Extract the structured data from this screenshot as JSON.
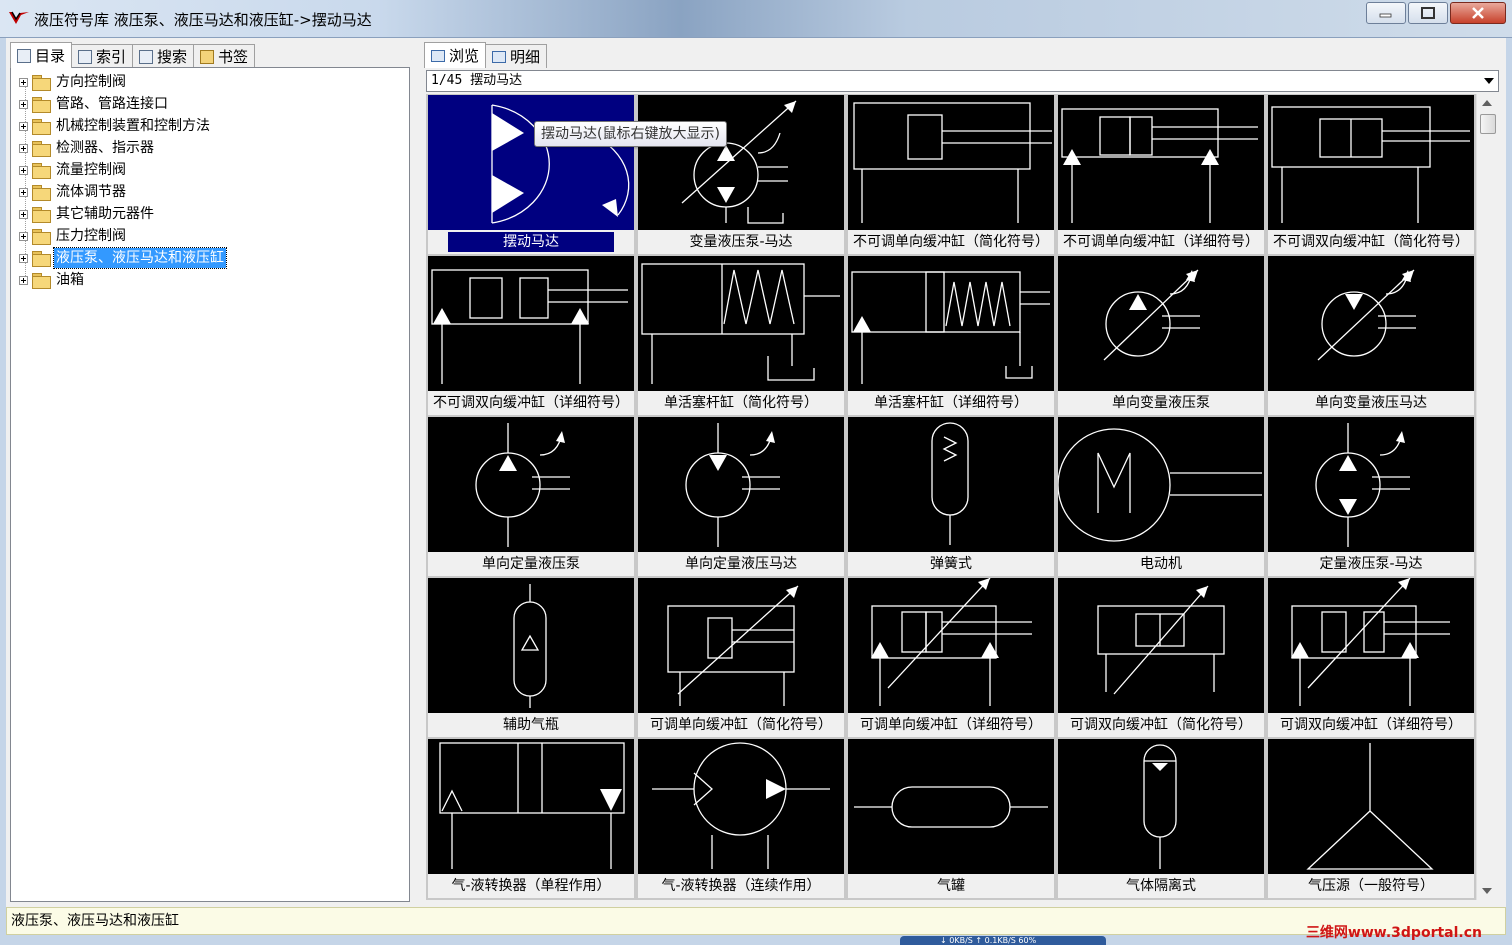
{
  "window": {
    "title": "液压符号库 液压泵、液压马达和液压缸->摆动马达"
  },
  "left_tabs": [
    {
      "label": "目录",
      "icon": "catalog-icon"
    },
    {
      "label": "索引",
      "icon": "index-icon"
    },
    {
      "label": "搜索",
      "icon": "search-icon"
    },
    {
      "label": "书签",
      "icon": "bookmark-icon"
    }
  ],
  "tree": [
    {
      "label": "方向控制阀"
    },
    {
      "label": "管路、管路连接口"
    },
    {
      "label": "机械控制装置和控制方法"
    },
    {
      "label": "检测器、指示器"
    },
    {
      "label": "流量控制阀"
    },
    {
      "label": "流体调节器"
    },
    {
      "label": "其它辅助元器件"
    },
    {
      "label": "压力控制阀"
    },
    {
      "label": "液压泵、液压马达和液压缸",
      "selected": true
    },
    {
      "label": "油箱"
    }
  ],
  "right_tabs": [
    {
      "label": "浏览",
      "icon": "browse-icon"
    },
    {
      "label": "明细",
      "icon": "detail-icon"
    }
  ],
  "path": "1/45 摆动马达",
  "tooltip": "摆动马达(鼠标右键放大显示)",
  "symbols": [
    {
      "label": "摆动马达",
      "kind": "swing-motor"
    },
    {
      "label": "变量液压泵-马达",
      "kind": "var-pump-motor"
    },
    {
      "label": "不可调单向缓冲缸（简化符号）",
      "kind": "cyl-simple"
    },
    {
      "label": "不可调单向缓冲缸（详细符号）",
      "kind": "cyl-detail"
    },
    {
      "label": "不可调双向缓冲缸（简化符号）",
      "kind": "cyl-double-simple"
    },
    {
      "label": "不可调双向缓冲缸（详细符号）",
      "kind": "cyl-double-detail"
    },
    {
      "label": "单活塞杆缸（简化符号）",
      "kind": "spring-cyl"
    },
    {
      "label": "单活塞杆缸（详细符号）",
      "kind": "spring-cyl-detail"
    },
    {
      "label": "单向变量液压泵",
      "kind": "var-pump"
    },
    {
      "label": "单向变量液压马达",
      "kind": "var-motor"
    },
    {
      "label": "单向定量液压泵",
      "kind": "fixed-pump"
    },
    {
      "label": "单向定量液压马达",
      "kind": "fixed-motor"
    },
    {
      "label": "弹簧式",
      "kind": "spring-accum"
    },
    {
      "label": "电动机",
      "kind": "electric-motor"
    },
    {
      "label": "定量液压泵-马达",
      "kind": "fixed-pump-motor"
    },
    {
      "label": "辅助气瓶",
      "kind": "aux-bottle"
    },
    {
      "label": "可调单向缓冲缸（简化符号）",
      "kind": "adj-cyl-simple"
    },
    {
      "label": "可调单向缓冲缸（详细符号）",
      "kind": "adj-cyl-detail"
    },
    {
      "label": "可调双向缓冲缸（简化符号）",
      "kind": "adj-cyl-double-simple"
    },
    {
      "label": "可调双向缓冲缸（详细符号）",
      "kind": "adj-cyl-double-detail"
    },
    {
      "label": "气-液转换器（单程作用）",
      "kind": "conv-single"
    },
    {
      "label": "气-液转换器（连续作用）",
      "kind": "conv-cont"
    },
    {
      "label": "气罐",
      "kind": "air-tank"
    },
    {
      "label": "气体隔离式",
      "kind": "gas-sep"
    },
    {
      "label": "气压源（一般符号）",
      "kind": "air-source"
    }
  ],
  "status": "液压泵、液压马达和液压缸",
  "watermark": "三维网www.3dportal.cn",
  "network": "↓ 0KB/S  ↑ 0.1KB/S  60%",
  "colors": {
    "selection": "#000080",
    "tree_selection": "#3399ff",
    "thumb_bg": "#000000",
    "status_bg": "#fbfbe6"
  }
}
